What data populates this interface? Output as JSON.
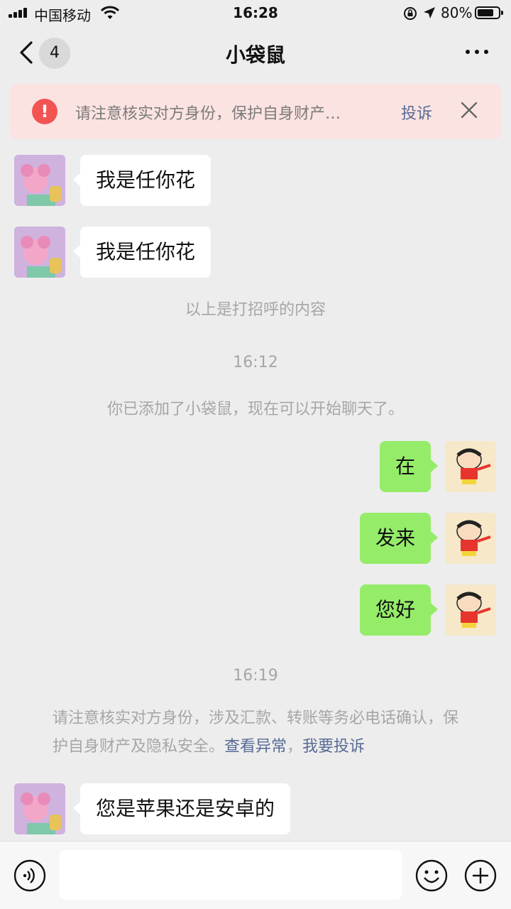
{
  "status_bar": {
    "carrier": "中国移动",
    "time": "16:28",
    "battery": "80%",
    "battery_level": 0.8
  },
  "header": {
    "back_icon": "chevron-left-icon",
    "unread_count": "4",
    "title": "小袋鼠",
    "more_icon": "more-dots-icon"
  },
  "banner": {
    "text": "请注意核实对方身份，保护自身财产…",
    "report_label": "投诉",
    "close_icon": "close-icon",
    "color": "#fbe3e1"
  },
  "messages": [
    {
      "from": "other",
      "text": "我是任你花"
    },
    {
      "from": "other",
      "text": "我是任你花"
    },
    {
      "from": "system",
      "text": "以上是打招呼的内容"
    },
    {
      "from": "system",
      "text": "16:12"
    },
    {
      "from": "system",
      "text": "你已添加了小袋鼠，现在可以开始聊天了。"
    },
    {
      "from": "me",
      "text": "在"
    },
    {
      "from": "me",
      "text": "发来"
    },
    {
      "from": "me",
      "text": "您好"
    },
    {
      "from": "system",
      "text": "16:19"
    },
    {
      "from": "other",
      "text": "您是苹果还是安卓的"
    }
  ],
  "security_notice": {
    "text": "请注意核实对方身份，涉及汇款、转账等务必电话确认，保护自身财产及隐私安全。",
    "link_view": "查看异常",
    "separator": "，",
    "link_report": "我要投诉"
  },
  "input_bar": {
    "voice_icon": "voice-icon",
    "input_value": "",
    "emoji_icon": "emoji-icon",
    "plus_icon": "plus-icon"
  },
  "colors": {
    "my_bubble": "#95ec69",
    "their_bubble": "#ffffff",
    "link": "#576b95",
    "background": "#ededed"
  }
}
